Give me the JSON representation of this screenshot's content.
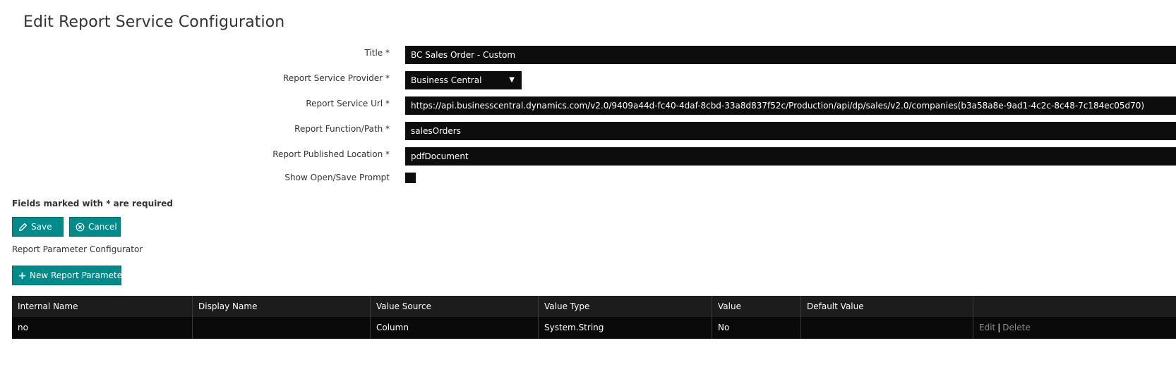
{
  "page": {
    "title": "Edit Report Service Configuration"
  },
  "form": {
    "title_label": "Title *",
    "title_value": "BC Sales Order - Custom",
    "provider_label": "Report Service Provider *",
    "provider_value": "Business Central",
    "url_label": "Report Service Url *",
    "url_value": "https://api.businesscentral.dynamics.com/v2.0/9409a44d-fc40-4daf-8cbd-33a8d837f52c/Production/api/dp/sales/v2.0/companies(b3a58a8e-9ad1-4c2c-8c48-7c184ec05d70)",
    "function_label": "Report Function/Path *",
    "function_value": "salesOrders",
    "location_label": "Report Published Location *",
    "location_value": "pdfDocument",
    "prompt_label": "Show Open/Save Prompt"
  },
  "required_note": "Fields marked with * are required",
  "buttons": {
    "save": "Save",
    "cancel": "Cancel",
    "new_parameter": "New Report Parameter"
  },
  "section_label": "Report Parameter Configurator",
  "table": {
    "headers": [
      "Internal Name",
      "Display Name",
      "Value Source",
      "Value Type",
      "Value",
      "Default Value",
      ""
    ],
    "rows": [
      {
        "internal_name": "no",
        "display_name": "",
        "value_source": "Column",
        "value_type": "System.String",
        "value": "No",
        "default_value": "",
        "edit": "Edit",
        "separator": "|",
        "delete": "Delete"
      }
    ]
  },
  "colors": {
    "accent": "#008b8b",
    "input_bg": "#0d0d0d",
    "grid_header_bg": "#1c1c1c"
  }
}
